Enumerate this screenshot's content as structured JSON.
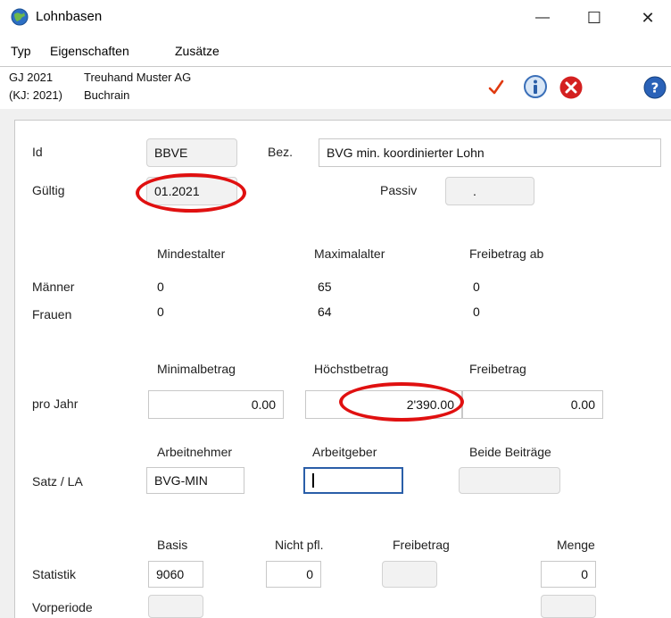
{
  "window": {
    "title": "Lohnbasen",
    "minimize": "—",
    "maximize": "☐",
    "close": "✕"
  },
  "menu": {
    "items": [
      "Typ",
      "Eigenschaften",
      "Zusätze"
    ]
  },
  "header": {
    "gj": "GJ 2021",
    "kj": "(KJ: 2021)",
    "company": "Treuhand Muster AG",
    "location": "Buchrain",
    "icons": [
      "check-icon",
      "info-icon",
      "cancel-icon",
      "help-icon"
    ]
  },
  "form": {
    "id_label": "Id",
    "id_value": "BBVE",
    "bez_label": "Bez.",
    "bez_value": "BVG min. koordinierter Lohn",
    "gueltig_label": "Gültig",
    "gueltig_value": "01.2021",
    "passiv_label": "Passiv",
    "passiv_value": ".",
    "age": {
      "headers": [
        "Mindestalter",
        "Maximalalter",
        "Freibetrag ab"
      ],
      "maenner_label": "Männer",
      "maenner": [
        "0",
        "65",
        "0"
      ],
      "frauen_label": "Frauen",
      "frauen": [
        "0",
        "64",
        "0"
      ]
    },
    "amounts": {
      "headers": [
        "Minimalbetrag",
        "Höchstbetrag",
        "Freibetrag"
      ],
      "row_label": "pro Jahr",
      "values": [
        "0.00",
        "2'390.00",
        "0.00"
      ]
    },
    "satz": {
      "headers": [
        "Arbeitnehmer",
        "Arbeitgeber",
        "Beide Beiträge"
      ],
      "row_label": "Satz / LA",
      "values": [
        "BVG-MIN",
        "",
        ""
      ]
    },
    "stat": {
      "headers": [
        "Basis",
        "Nicht pfl.",
        "Freibetrag",
        "Menge"
      ],
      "statistik_label": "Statistik",
      "statistik": [
        "9060",
        "0",
        "",
        "0"
      ],
      "vorperiode_label": "Vorperiode"
    }
  },
  "colors": {
    "highlight": "#e01010",
    "active_border": "#2a5ea8"
  }
}
